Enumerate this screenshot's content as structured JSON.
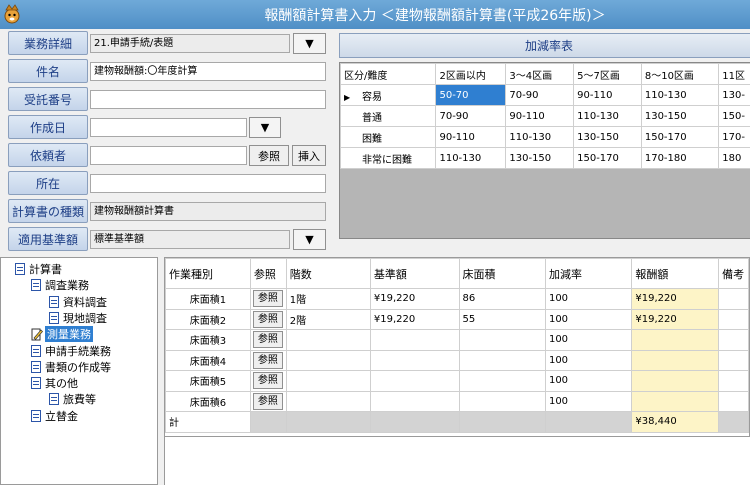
{
  "window": {
    "title": "報酬額計算書入力 ＜建物報酬額計算書(平成26年版)＞"
  },
  "form": {
    "business_detail": {
      "label": "業務詳細",
      "value": "21.申請手続/表題"
    },
    "case_name": {
      "label": "件名",
      "value": "建物報酬額:〇年度計算"
    },
    "receipt_no": {
      "label": "受託番号",
      "value": ""
    },
    "created_date": {
      "label": "作成日",
      "value": ""
    },
    "client": {
      "label": "依頼者",
      "value": "",
      "ref_label": "参照",
      "insert_label": "挿入"
    },
    "location": {
      "label": "所在",
      "value": ""
    },
    "sheet_type": {
      "label": "計算書の種類",
      "value": "建物報酬額計算書"
    },
    "standard": {
      "label": "適用基準額",
      "value": "標準基準額"
    }
  },
  "rate_table": {
    "title": "加減率表",
    "headers": [
      "区分/難度",
      "2区画以内",
      "3～4区画",
      "5～7区画",
      "8～10区画",
      "11区"
    ],
    "rows": [
      {
        "marker": "▶",
        "name": "容易",
        "cells": [
          "50-70",
          "70-90",
          "90-110",
          "110-130",
          "130-"
        ]
      },
      {
        "marker": "",
        "name": "普通",
        "cells": [
          "70-90",
          "90-110",
          "110-130",
          "130-150",
          "150-"
        ]
      },
      {
        "marker": "",
        "name": "困難",
        "cells": [
          "90-110",
          "110-130",
          "130-150",
          "150-170",
          "170-"
        ]
      },
      {
        "marker": "",
        "name": "非常に困難",
        "cells": [
          "110-130",
          "130-150",
          "150-170",
          "170-180",
          "180"
        ]
      }
    ]
  },
  "tree": {
    "items": [
      {
        "label": "計算書",
        "level": 0
      },
      {
        "label": "調査業務",
        "level": 1
      },
      {
        "label": "資料調査",
        "level": 2
      },
      {
        "label": "現地調査",
        "level": 2
      },
      {
        "label": "測量業務",
        "level": 1,
        "selected": true
      },
      {
        "label": "申請手続業務",
        "level": 1
      },
      {
        "label": "書類の作成等",
        "level": 1
      },
      {
        "label": "其の他",
        "level": 1
      },
      {
        "label": "旅費等",
        "level": 2
      },
      {
        "label": "立替金",
        "level": 1
      }
    ]
  },
  "work_grid": {
    "headers": [
      "作業種別",
      "参照",
      "階数",
      "基準額",
      "床面積",
      "加減率",
      "報酬額",
      "備考"
    ],
    "ref_label": "参照",
    "rows": [
      {
        "name": "床面積1",
        "floors": "1階",
        "base": "¥19,220",
        "area": "86",
        "rate": "100",
        "fee": "¥19,220"
      },
      {
        "name": "床面積2",
        "floors": "2階",
        "base": "¥19,220",
        "area": "55",
        "rate": "100",
        "fee": "¥19,220"
      },
      {
        "name": "床面積3",
        "floors": "",
        "base": "",
        "area": "",
        "rate": "100",
        "fee": ""
      },
      {
        "name": "床面積4",
        "floors": "",
        "base": "",
        "area": "",
        "rate": "100",
        "fee": ""
      },
      {
        "name": "床面積5",
        "floors": "",
        "base": "",
        "area": "",
        "rate": "100",
        "fee": ""
      },
      {
        "name": "床面積6",
        "floors": "",
        "base": "",
        "area": "",
        "rate": "100",
        "fee": ""
      }
    ],
    "total": {
      "label": "計",
      "fee": "¥38,440"
    }
  },
  "colors": {
    "title_bar": "#5b9bd5",
    "selection": "#2f7fd1",
    "fee_highlight": "#fdf4c7",
    "label_text": "#1d3e86"
  }
}
